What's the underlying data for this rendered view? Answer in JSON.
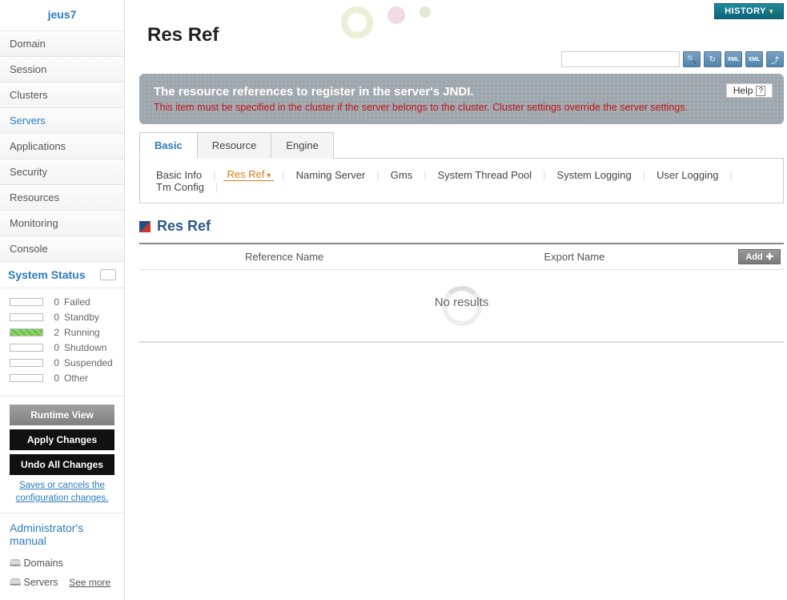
{
  "brand": "jeus7",
  "nav": {
    "domain": "Domain",
    "session": "Session",
    "clusters": "Clusters",
    "servers": "Servers",
    "applications": "Applications",
    "security": "Security",
    "resources": "Resources",
    "monitoring": "Monitoring",
    "console": "Console"
  },
  "system_status": {
    "title": "System Status",
    "failed": {
      "count": "0",
      "label": "Failed"
    },
    "standby": {
      "count": "0",
      "label": "Standby"
    },
    "running": {
      "count": "2",
      "label": "Running"
    },
    "shutdown": {
      "count": "0",
      "label": "Shutdown"
    },
    "suspended": {
      "count": "0",
      "label": "Suspended"
    },
    "other": {
      "count": "0",
      "label": "Other"
    }
  },
  "actions": {
    "runtime_view": "Runtime View",
    "apply": "Apply Changes",
    "undo": "Undo All Changes",
    "hint": "Saves or cancels the configuration changes."
  },
  "manual": {
    "title": "Administrator's manual",
    "domains": "Domains",
    "servers": "Servers",
    "see_more": "See more"
  },
  "topbar": {
    "history": "HISTORY"
  },
  "page_title": "Res Ref",
  "search": {
    "placeholder": ""
  },
  "banner": {
    "title": "The resource references to register in the server's JNDI.",
    "warning": "This item must be specified in the cluster if the server belongs to the cluster. Cluster settings override the server settings.",
    "help": "Help"
  },
  "tabs": {
    "basic": "Basic",
    "resource": "Resource",
    "engine": "Engine"
  },
  "subtabs": {
    "basic_info": "Basic Info",
    "res_ref": "Res Ref",
    "naming_server": "Naming Server",
    "gms": "Gms",
    "system_thread_pool": "System Thread Pool",
    "system_logging": "System Logging",
    "user_logging": "User Logging",
    "tm_config": "Tm Config"
  },
  "section": {
    "title": "Res Ref"
  },
  "table": {
    "ref_name": "Reference Name",
    "export_name": "Export Name",
    "add": "Add",
    "no_results": "No results"
  }
}
